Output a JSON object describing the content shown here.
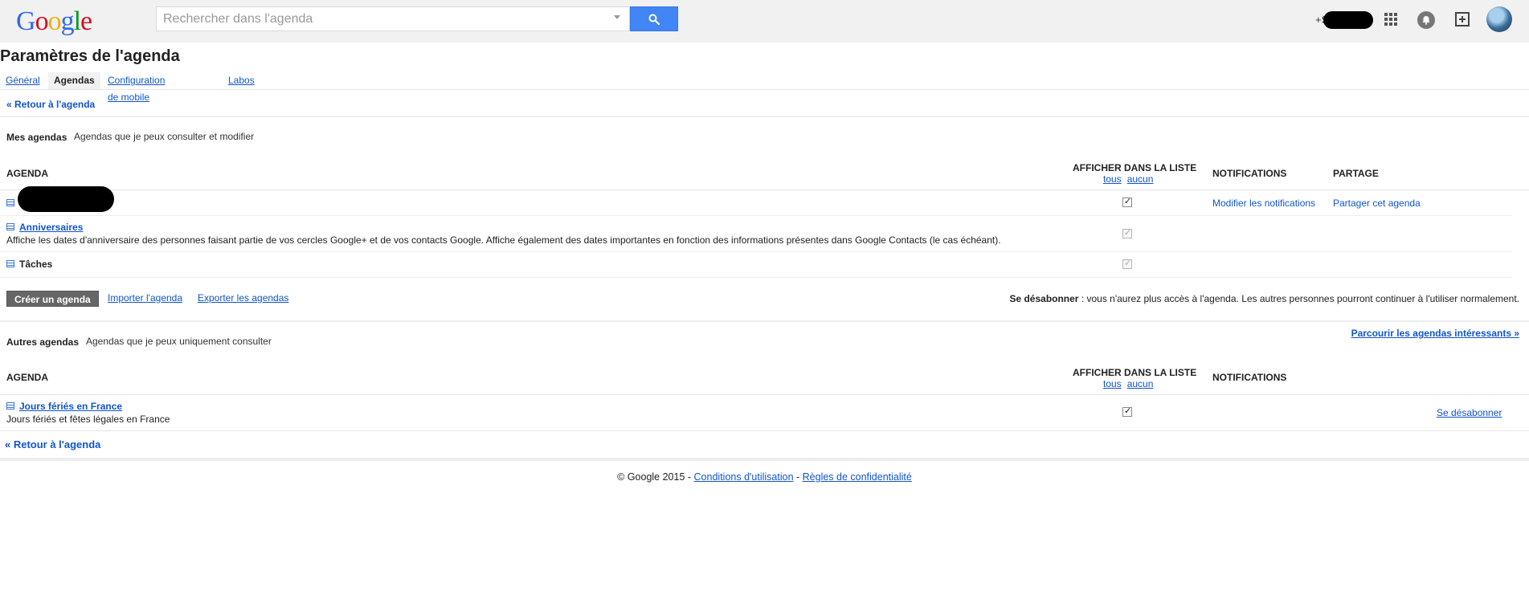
{
  "header": {
    "logo": [
      "G",
      "o",
      "o",
      "g",
      "l",
      "e"
    ],
    "logo_colors": [
      "#3369e8",
      "#d50f25",
      "#eeb211",
      "#3369e8",
      "#009925",
      "#d50f25"
    ],
    "search": {
      "placeholder": "Rechercher dans l'agenda",
      "value": ""
    },
    "user_name": "+S"
  },
  "page": {
    "title": "Paramètres de l'agenda",
    "tabs": [
      {
        "label": "Général",
        "active": false
      },
      {
        "label": "Agendas",
        "active": true
      },
      {
        "label": "Configuration de mobile",
        "active": false
      },
      {
        "label": "Labos",
        "active": false
      }
    ],
    "back_link": "« Retour à l'agenda"
  },
  "my_calendars": {
    "title": "Mes agendas",
    "desc": "Agendas que je peux consulter et modifier",
    "columns": {
      "agenda": "AGENDA",
      "show": "AFFICHER DANS LA LISTE",
      "show_all": "tous",
      "show_none": "aucun",
      "notifications": "NOTIFICATIONS",
      "sharing": "PARTAGE"
    },
    "rows": [
      {
        "name": "",
        "desc": "",
        "checked": true,
        "notif_link": "Modifier les notifications",
        "share_link": "Partager cet agenda"
      },
      {
        "name": "Anniversaires",
        "desc": "Affiche les dates d'anniversaire des personnes faisant partie de vos cercles Google+ et de vos contacts Google. Affiche également des dates importantes en fonction des informations présentes dans Google Contacts (le cas échéant).",
        "checked": true
      },
      {
        "name": "Tâches",
        "desc": "",
        "checked": true
      }
    ],
    "create_button": "Créer un agenda",
    "import_link": "Importer l'agenda",
    "export_link": "Exporter les agendas",
    "unsubscribe_note_bold": "Se désabonner",
    "unsubscribe_note": " : vous n'aurez plus accès à l'agenda. Les autres personnes pourront continuer à l'utiliser normalement."
  },
  "other_calendars": {
    "title": "Autres agendas",
    "desc": "Agendas que je peux uniquement consulter",
    "browse_link": "Parcourir les agendas intéressants »",
    "columns": {
      "agenda": "AGENDA",
      "show": "AFFICHER DANS LA LISTE",
      "show_all": "tous",
      "show_none": "aucun",
      "notifications": "NOTIFICATIONS"
    },
    "rows": [
      {
        "name": "Jours fériés en France",
        "desc": "Jours fériés et fêtes légales en France",
        "checked": true,
        "unsubscribe_link": "Se désabonner"
      }
    ]
  },
  "bottom_back_link": "« Retour à l'agenda",
  "footer": {
    "copyright": "© Google 2015 - ",
    "terms": "Conditions d'utilisation",
    "sep": " - ",
    "privacy": "Règles de confidentialité"
  }
}
